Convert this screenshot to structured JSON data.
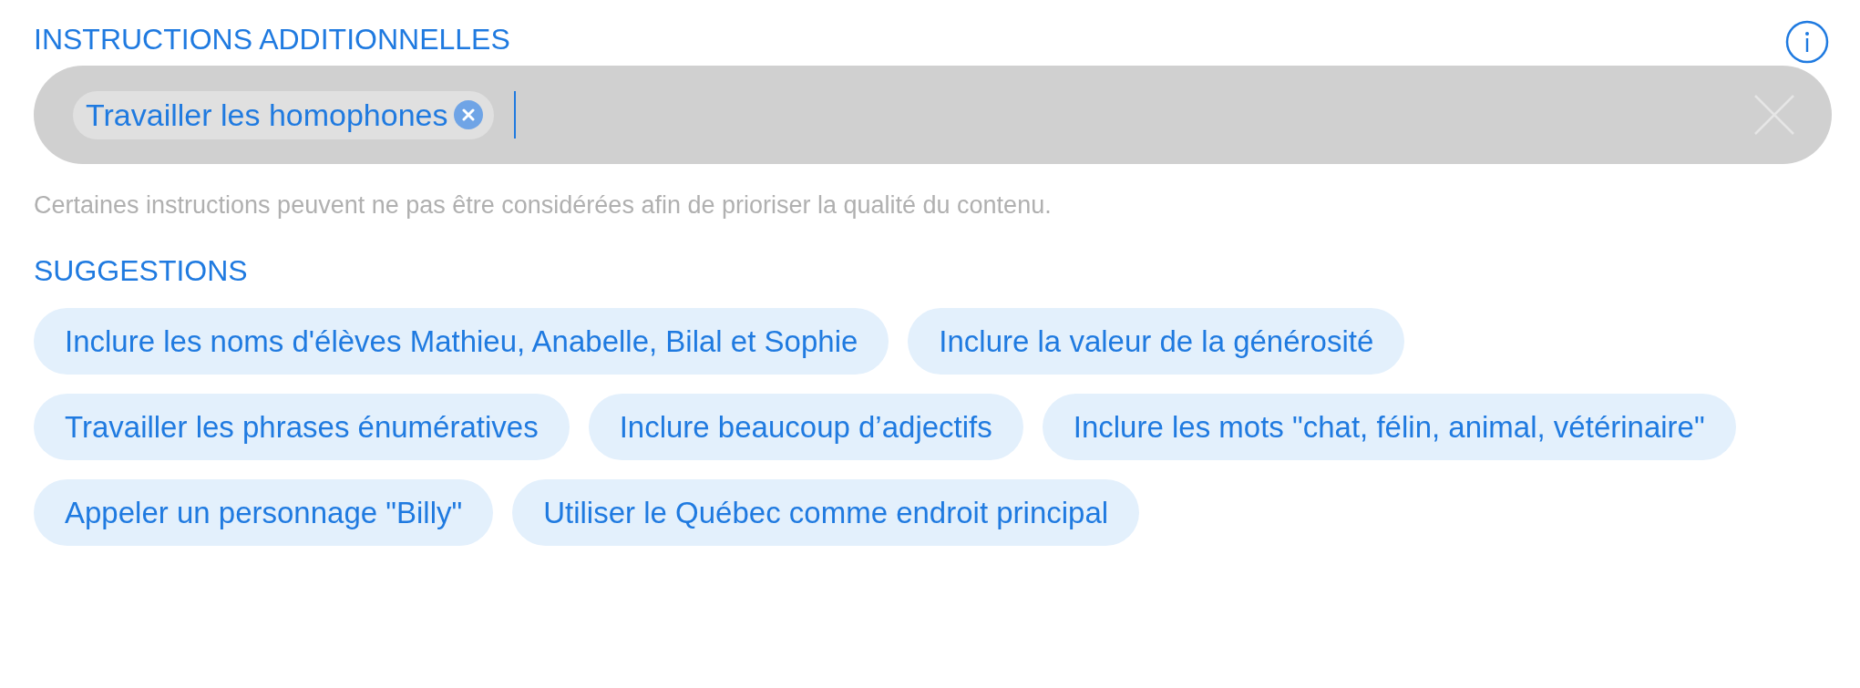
{
  "section_title": "INSTRUCTIONS ADDITIONNELLES",
  "field": {
    "tags": [
      {
        "label": "Travailler les homophones"
      }
    ]
  },
  "helper_text": "Certaines instructions peuvent ne pas être considérées afin de prioriser la qualité du contenu.",
  "suggestions_title": "SUGGESTIONS",
  "suggestions": [
    {
      "label": "Inclure les noms d'élèves Mathieu, Anabelle, Bilal et Sophie"
    },
    {
      "label": "Inclure la valeur de la générosité"
    },
    {
      "label": "Travailler les phrases énumératives"
    },
    {
      "label": "Inclure beaucoup d’adjectifs"
    },
    {
      "label": "Inclure les mots \"chat, félin, animal, vétérinaire\""
    },
    {
      "label": "Appeler un personnage \"Billy\""
    },
    {
      "label": "Utiliser le Québec comme endroit principal"
    }
  ]
}
